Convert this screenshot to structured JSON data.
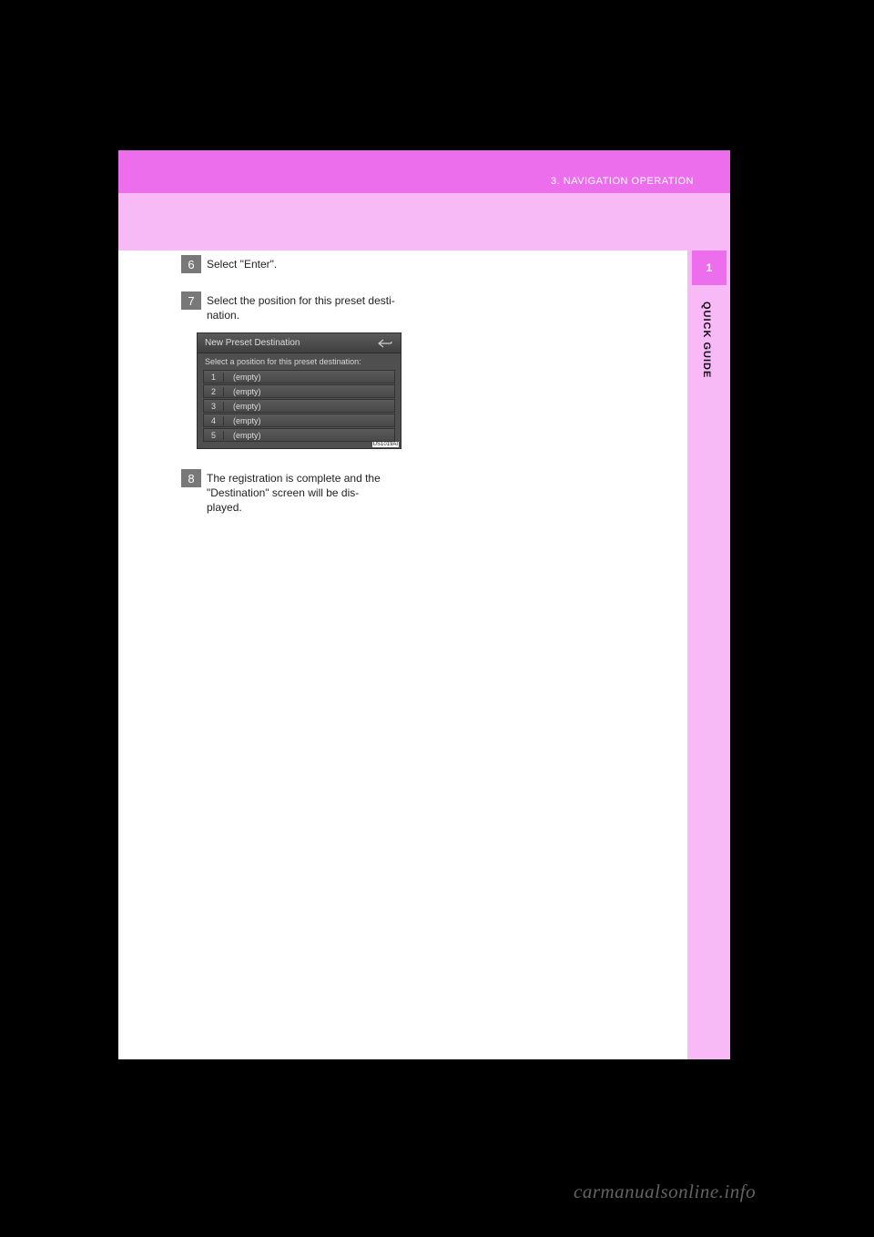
{
  "header": {
    "section_title": "3. NAVIGATION OPERATION",
    "chapter_number": "1",
    "side_label": "QUICK GUIDE"
  },
  "steps": {
    "s6": {
      "num": "6",
      "text": "Select \"Enter\"."
    },
    "s7": {
      "num": "7",
      "line1": "Select the position for this preset desti-",
      "line2": "nation."
    },
    "s8": {
      "num": "8",
      "line1": "The registration is complete and the",
      "line2": "\"Destination\" screen will be dis-",
      "line3": "played."
    }
  },
  "screenshot": {
    "title": "New Preset Destination",
    "subtitle": "Select a position for this preset destination:",
    "rows": [
      {
        "num": "1",
        "label": "(empty)"
      },
      {
        "num": "2",
        "label": "(empty)"
      },
      {
        "num": "3",
        "label": "(empty)"
      },
      {
        "num": "4",
        "label": "(empty)"
      },
      {
        "num": "5",
        "label": "(empty)"
      }
    ],
    "code": "US1019AI",
    "back_icon": "back-icon"
  },
  "watermark": "carmanualsonline.info"
}
